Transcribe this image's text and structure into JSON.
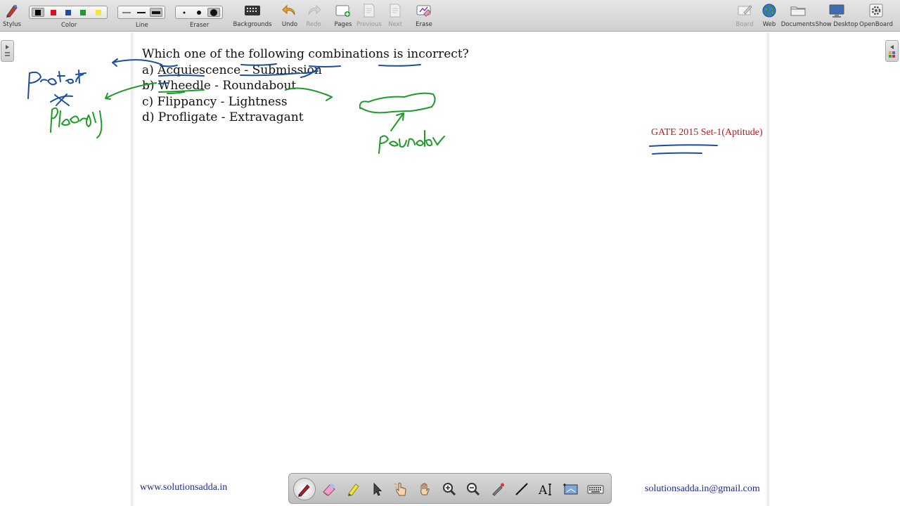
{
  "toolbar": {
    "stylus_label": "Stylus",
    "color_label": "Color",
    "line_label": "Line",
    "eraser_label": "Eraser",
    "backgrounds_label": "Backgrounds",
    "undo_label": "Undo",
    "redo_label": "Redo",
    "pages_label": "Pages",
    "previous_label": "Previous",
    "next_label": "Next",
    "erase_label": "Erase",
    "board_label": "Board",
    "web_label": "Web",
    "documents_label": "Documents",
    "show_desktop_label": "Show Desktop",
    "openboard_label": "OpenBoard",
    "colors": [
      "#000000",
      "#d4121a",
      "#1b4e9b",
      "#1f9a2a",
      "#f1e83a"
    ],
    "selected_color": "#000000"
  },
  "content": {
    "question": "Which one of the following combinations is incorrect?",
    "options": [
      "a) Acquiescence - Submission",
      "b) Wheedle - Roundabout",
      "c) Flippancy - Lightness",
      "d) Profligate - Extravagant"
    ],
    "exam_tag": "GATE 2015 Set-1(Aptitude)",
    "website": "www.solutionsadda.in",
    "email": "solutionsadda.in@gmail.com"
  },
  "palette": {
    "tools": [
      "pen-icon",
      "eraser-icon",
      "highlighter-icon",
      "pointer-icon",
      "interact-icon",
      "hand-icon",
      "zoom-in-icon",
      "zoom-out-icon",
      "laser-icon",
      "line-icon",
      "text-icon",
      "capture-icon",
      "keyboard-icon"
    ],
    "selected": "pen-icon"
  },
  "colors": {
    "ink_blue": "#1b4e9b",
    "ink_green": "#1f9a2a",
    "tag_red": "#c0161c",
    "footer_blue": "#1d2a8f"
  }
}
